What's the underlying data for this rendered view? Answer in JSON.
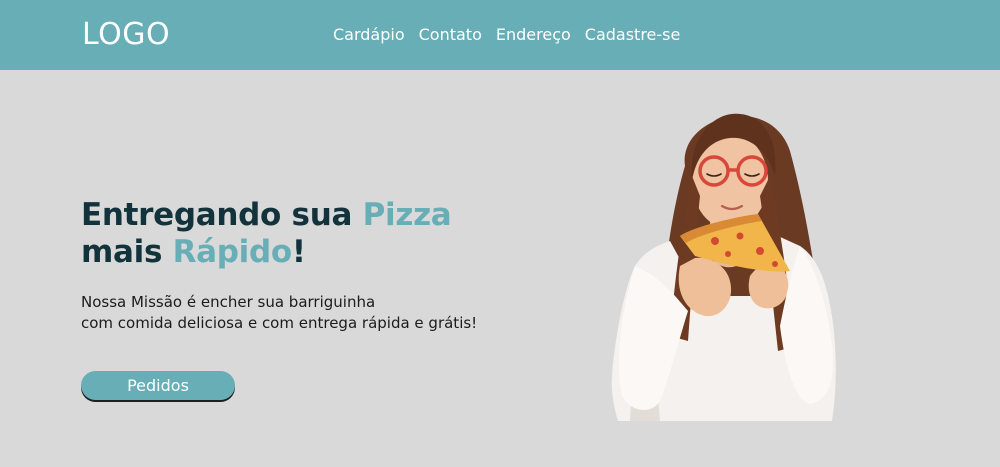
{
  "header": {
    "logo": "LOGO",
    "nav": [
      {
        "label": "Cardápio"
      },
      {
        "label": "Contato"
      },
      {
        "label": "Endereço"
      },
      {
        "label": "Cadastre-se"
      }
    ]
  },
  "hero": {
    "title_part1": "Entregando sua ",
    "title_accent1": "Pizza",
    "title_part2": "mais ",
    "title_accent2": "Rápido",
    "title_part3": "!",
    "subtitle_line1": "Nossa Missão é encher sua barriguinha",
    "subtitle_line2": "com comida deliciosa e com entrega rápida e grátis!",
    "cta_label": "Pedidos"
  },
  "colors": {
    "header_bg": "#67aeb7",
    "page_bg": "#d9d9d9",
    "accent": "#67aeb7",
    "title_dark": "#12333b"
  }
}
